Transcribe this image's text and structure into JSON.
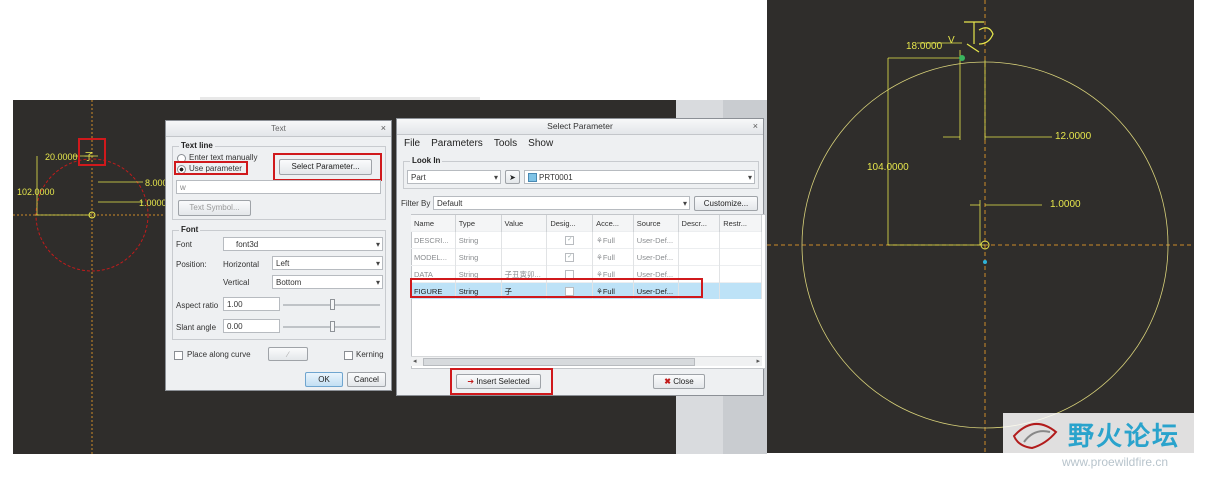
{
  "sketch_left": {
    "dims": [
      "20.0000",
      "102.0000",
      "8.000",
      "1.0000"
    ],
    "glyph": "子"
  },
  "text_dialog": {
    "title": "Text",
    "close": "×",
    "text_line_label": "Text line",
    "radio_manual": "Enter text manually",
    "radio_param": "Use parameter",
    "select_param_btn": "Select Parameter...",
    "text_value": "w",
    "text_symbol_btn": "Text Symbol...",
    "font_group": "Font",
    "font_label": "Font",
    "font_value": "font3d",
    "position_label": "Position:",
    "horizontal_label": "Horizontal",
    "horizontal_value": "Left",
    "vertical_label": "Vertical",
    "vertical_value": "Bottom",
    "aspect_label": "Aspect ratio",
    "aspect_value": "1.00",
    "slant_label": "Slant angle",
    "slant_value": "0.00",
    "along_curve": "Place along curve",
    "kerning": "Kerning",
    "ok": "OK",
    "cancel": "Cancel"
  },
  "select_dialog": {
    "title": "Select Parameter",
    "close": "×",
    "menu": [
      "File",
      "Parameters",
      "Tools",
      "Show"
    ],
    "look_in_label": "Look In",
    "look_in_value": "Part",
    "model_value": "PRT0001",
    "filter_label": "Filter By",
    "filter_value": "Default",
    "customize_btn": "Customize...",
    "columns": [
      "Name",
      "Type",
      "Value",
      "Desig...",
      "Acce...",
      "Source",
      "Descr...",
      "Restr..."
    ],
    "rows": [
      {
        "name": "DESCRI...",
        "type": "String",
        "value": "",
        "designated": true,
        "access": "Full",
        "source": "User-Def..."
      },
      {
        "name": "MODEL...",
        "type": "String",
        "value": "",
        "designated": true,
        "access": "Full",
        "source": "User-Def..."
      },
      {
        "name": "DATA",
        "type": "String",
        "value": "子丑寅卯...",
        "designated": false,
        "access": "Full",
        "source": "User-Def..."
      },
      {
        "name": "FIGURE",
        "type": "String",
        "value": "子",
        "designated": false,
        "access": "Full",
        "source": "User-Def..."
      }
    ],
    "insert_btn": "Insert Selected",
    "close_btn": "Close"
  },
  "sketch_right": {
    "dims": [
      "18.0000",
      "12.0000",
      "104.0000",
      "1.0000"
    ],
    "label_v": "V"
  },
  "watermark": {
    "cn": "野火论坛",
    "url": "www.proewildfire.cn"
  },
  "colors": {
    "sketch_bg": "#2f2d2b",
    "dimension": "#e6e64c",
    "highlight_red": "#d0191c",
    "selection": "#bde2f7"
  }
}
